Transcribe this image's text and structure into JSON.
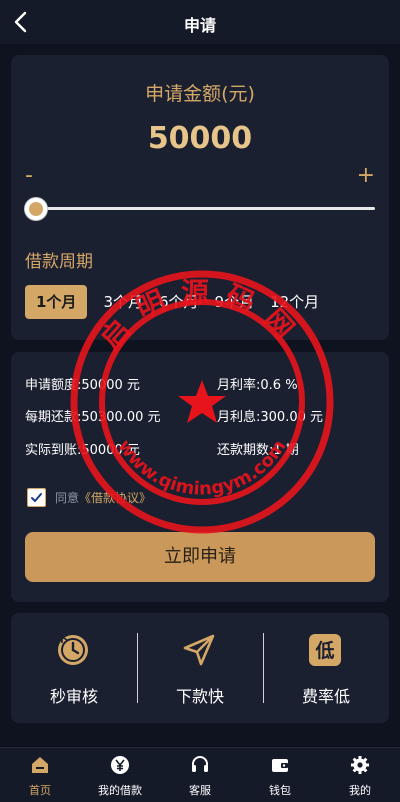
{
  "header": {
    "title": "申请",
    "back_icon": "chevron-left-icon"
  },
  "loan": {
    "amount_label": "申请金额(元)",
    "amount_value": "50000",
    "minus": "-",
    "plus": "+",
    "slider_fraction": 0.02,
    "period_label": "借款周期",
    "periods": [
      "1个月",
      "3个月",
      "6个月",
      "9个月",
      "12个月"
    ],
    "selected_period": "1个月"
  },
  "summary": {
    "quota_label": "申请额度:",
    "quota_value": "50000 元",
    "monthly_rate_label": "月利率:",
    "monthly_rate_value": "0.6 %",
    "installment_label": "每期还款:",
    "installment_value": "50300.00 元",
    "monthly_interest_label": "月利息:",
    "monthly_interest_value": "300.00 元",
    "received_label": "实际到账:",
    "received_value": "50000 元",
    "terms_label": "还款期数:",
    "terms_value": "1 期",
    "agree_prefix": "同意",
    "agree_link": "《借款协议》",
    "agree_checked": true,
    "apply_button": "立即申请"
  },
  "features": [
    {
      "icon": "clock-icon",
      "label": "秒审核"
    },
    {
      "icon": "send-icon",
      "label": "下款快"
    },
    {
      "icon": "low-rate-icon",
      "icon_text": "低",
      "label": "费率低"
    }
  ],
  "watermark": {
    "text_top": "启明源码网",
    "text_bottom": "www.qimingym.com"
  },
  "nav": {
    "items": [
      {
        "icon": "home-icon",
        "label": "首页",
        "active": true
      },
      {
        "icon": "yen-icon",
        "label": "我的借款",
        "active": false
      },
      {
        "icon": "headset-icon",
        "label": "客服",
        "active": false
      },
      {
        "icon": "wallet-icon",
        "label": "钱包",
        "active": false
      },
      {
        "icon": "gear-icon",
        "label": "我的",
        "active": false
      }
    ]
  },
  "colors": {
    "accent": "#d4a766",
    "background": "#0f1320",
    "card": "#1b2031",
    "watermark": "#e8141c"
  }
}
